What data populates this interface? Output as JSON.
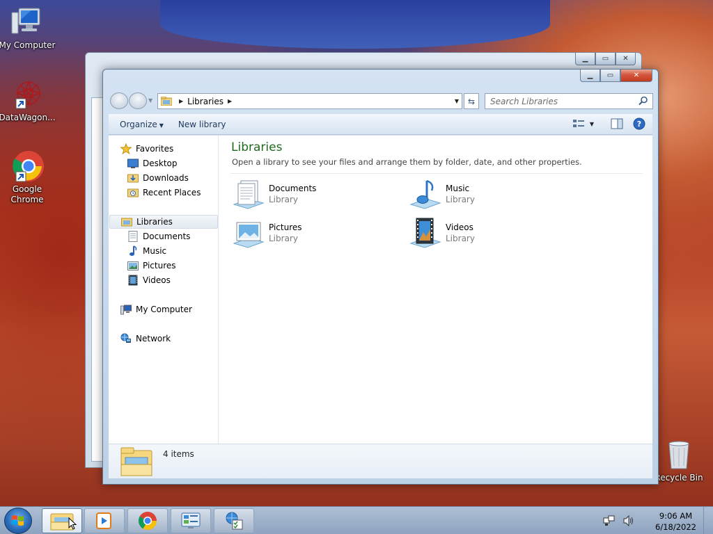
{
  "desktop": {
    "icons": [
      {
        "label": "My Computer"
      },
      {
        "label": "DataWagon..."
      },
      {
        "label": "Google Chrome"
      },
      {
        "label": "Recycle Bin"
      }
    ]
  },
  "window": {
    "address": {
      "crumbs": [
        "Libraries"
      ]
    },
    "search": {
      "placeholder": "Search Libraries"
    },
    "commands": {
      "organize": "Organize",
      "new_library": "New library"
    }
  },
  "nav_pane": {
    "favorites": "Favorites",
    "desktop": "Desktop",
    "downloads": "Downloads",
    "recent": "Recent Places",
    "libraries": "Libraries",
    "documents": "Documents",
    "music": "Music",
    "pictures": "Pictures",
    "videos": "Videos",
    "computer": "My Computer",
    "network": "Network"
  },
  "content": {
    "title": "Libraries",
    "description": "Open a library to see your files and arrange them by folder, date, and other properties.",
    "libraries": [
      {
        "name": "Documents",
        "type": "Library"
      },
      {
        "name": "Music",
        "type": "Library"
      },
      {
        "name": "Pictures",
        "type": "Library"
      },
      {
        "name": "Videos",
        "type": "Library"
      }
    ]
  },
  "details": {
    "count": "4 items"
  },
  "taskbar": {
    "time": "9:06 AM",
    "date": "6/18/2022"
  },
  "colors": {
    "library_title": "#1e6b1e",
    "command_text": "#1e395b",
    "close_button": "#c23a20"
  }
}
